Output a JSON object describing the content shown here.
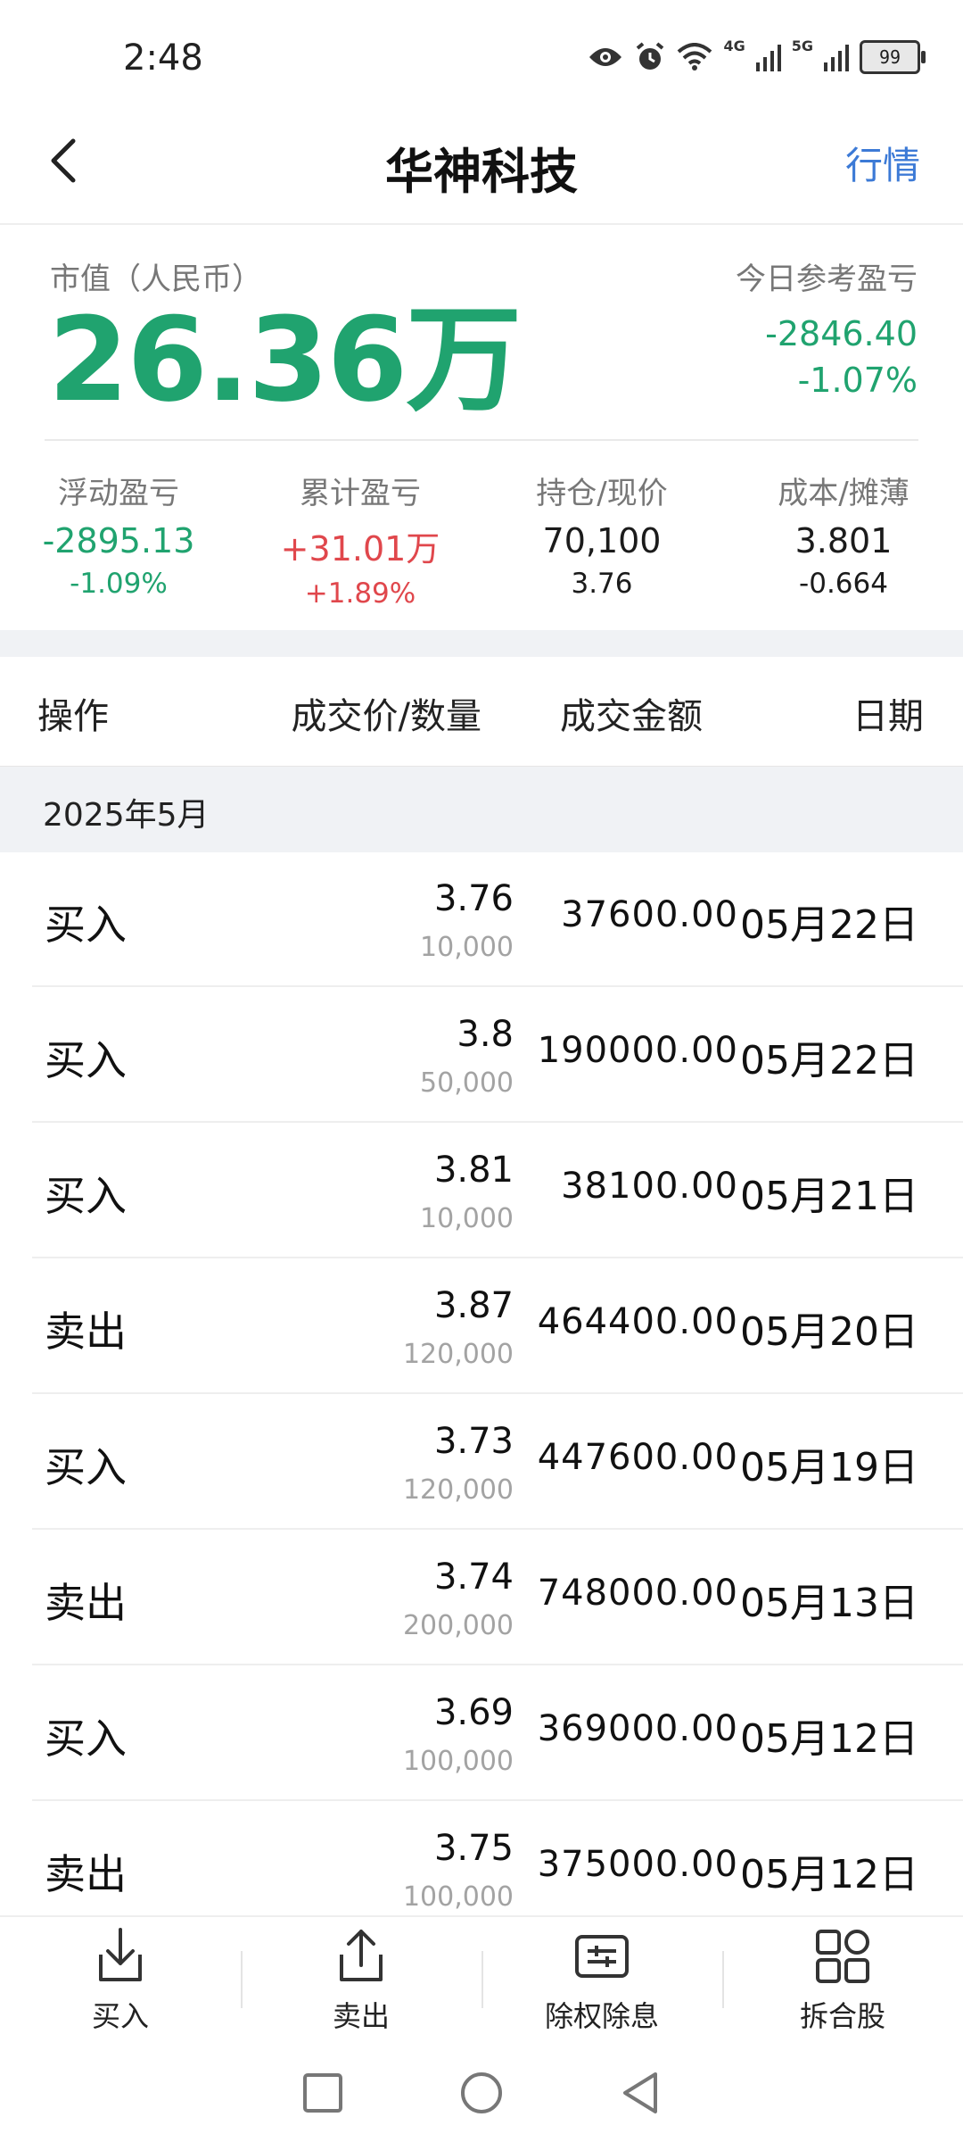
{
  "status_bar": {
    "time": "2:48",
    "net1": "4G",
    "net2": "5G",
    "battery": "99"
  },
  "header": {
    "title": "华神科技",
    "market_link": "行情"
  },
  "summary": {
    "market_value_label": "市值（人民币）",
    "market_value": "26.36万",
    "today_label": "今日参考盈亏",
    "today_value": "-2846.40",
    "today_pct": "-1.07%",
    "stats": [
      {
        "label": "浮动盈亏",
        "value1": "-2895.13",
        "value2": "-1.09%"
      },
      {
        "label": "累计盈亏",
        "value1": "+31.01万",
        "value2": "+1.89%"
      },
      {
        "label": "持仓/现价",
        "value1": "70,100",
        "value2": "3.76"
      },
      {
        "label": "成本/摊薄",
        "value1": "3.801",
        "value2": "-0.664"
      }
    ]
  },
  "table": {
    "headers": {
      "op": "操作",
      "price_qty": "成交价/数量",
      "amount": "成交金额",
      "date": "日期"
    },
    "month": "2025年5月",
    "rows": [
      {
        "op": "买入",
        "price": "3.76",
        "qty": "10,000",
        "amount": "37600.00",
        "date": "05月22日"
      },
      {
        "op": "买入",
        "price": "3.8",
        "qty": "50,000",
        "amount": "190000.00",
        "date": "05月22日"
      },
      {
        "op": "买入",
        "price": "3.81",
        "qty": "10,000",
        "amount": "38100.00",
        "date": "05月21日"
      },
      {
        "op": "卖出",
        "price": "3.87",
        "qty": "120,000",
        "amount": "464400.00",
        "date": "05月20日"
      },
      {
        "op": "买入",
        "price": "3.73",
        "qty": "120,000",
        "amount": "447600.00",
        "date": "05月19日"
      },
      {
        "op": "卖出",
        "price": "3.74",
        "qty": "200,000",
        "amount": "748000.00",
        "date": "05月13日"
      },
      {
        "op": "买入",
        "price": "3.69",
        "qty": "100,000",
        "amount": "369000.00",
        "date": "05月12日"
      },
      {
        "op": "卖出",
        "price": "3.75",
        "qty": "100,000",
        "amount": "375000.00",
        "date": "05月12日"
      }
    ]
  },
  "toolbar": {
    "buy": "买入",
    "sell": "卖出",
    "ex_rights": "除权除息",
    "split_merge": "拆合股"
  },
  "colors": {
    "loss_green": "#20a36f",
    "gain_red": "#e0474c",
    "link_blue": "#3c7ad6"
  }
}
